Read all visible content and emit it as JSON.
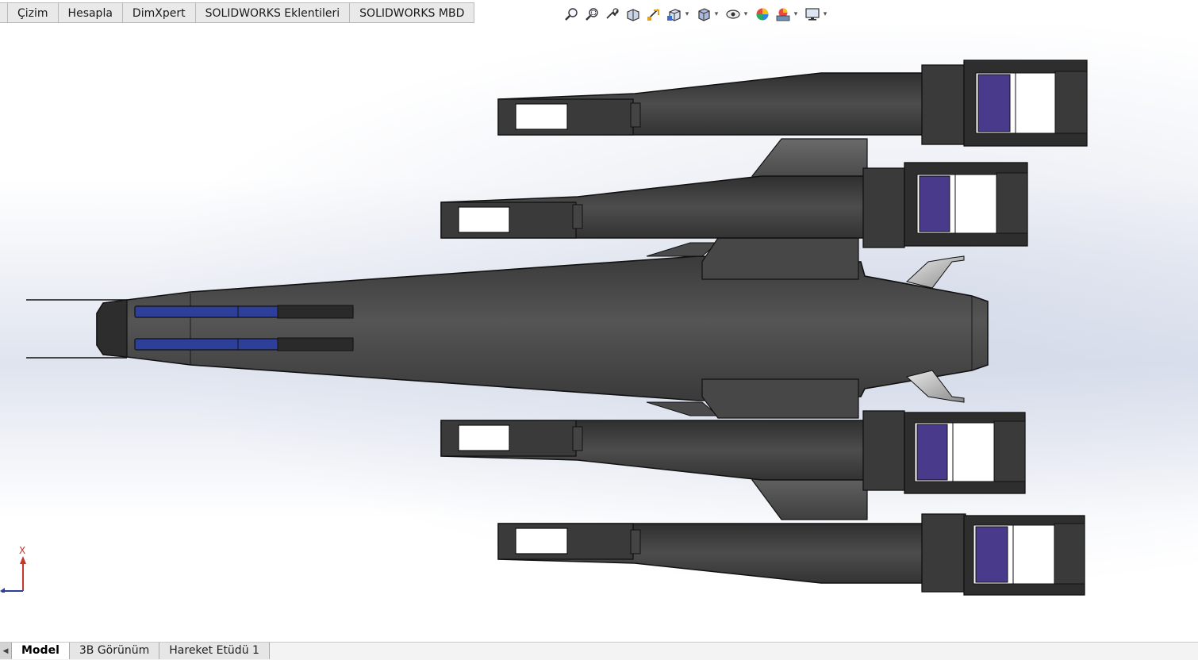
{
  "top_tabs": [
    {
      "label": "Çizim"
    },
    {
      "label": "Hesapla"
    },
    {
      "label": "DimXpert"
    },
    {
      "label": "SOLIDWORKS Eklentileri"
    },
    {
      "label": "SOLIDWORKS MBD"
    }
  ],
  "heads_up_toolbar": [
    {
      "icon": "zoom-to-fit-icon"
    },
    {
      "icon": "zoom-to-area-icon"
    },
    {
      "icon": "previous-view-icon"
    },
    {
      "icon": "section-view-icon"
    },
    {
      "icon": "dynamic-annotation-icon"
    },
    {
      "icon": "view-orientation-icon"
    },
    {
      "icon": "display-style-icon"
    },
    {
      "icon": "hide-show-items-icon"
    },
    {
      "icon": "edit-appearance-icon"
    },
    {
      "icon": "apply-scene-icon"
    },
    {
      "icon": "view-settings-icon"
    }
  ],
  "triad": {
    "axis_label": "X"
  },
  "bottom_tabs": [
    {
      "label": "Model",
      "active": true
    },
    {
      "label": "3B Görünüm",
      "active": false
    },
    {
      "label": "Hareket Etüdü 1",
      "active": false
    }
  ],
  "colors": {
    "body": "#4a4a4a",
    "body_dark": "#2e2e2e",
    "outline": "#111111",
    "accent_purple": "#4a3a8c",
    "accent_blue": "#2e3f9a",
    "fin_silver": "#b8b8b8"
  }
}
